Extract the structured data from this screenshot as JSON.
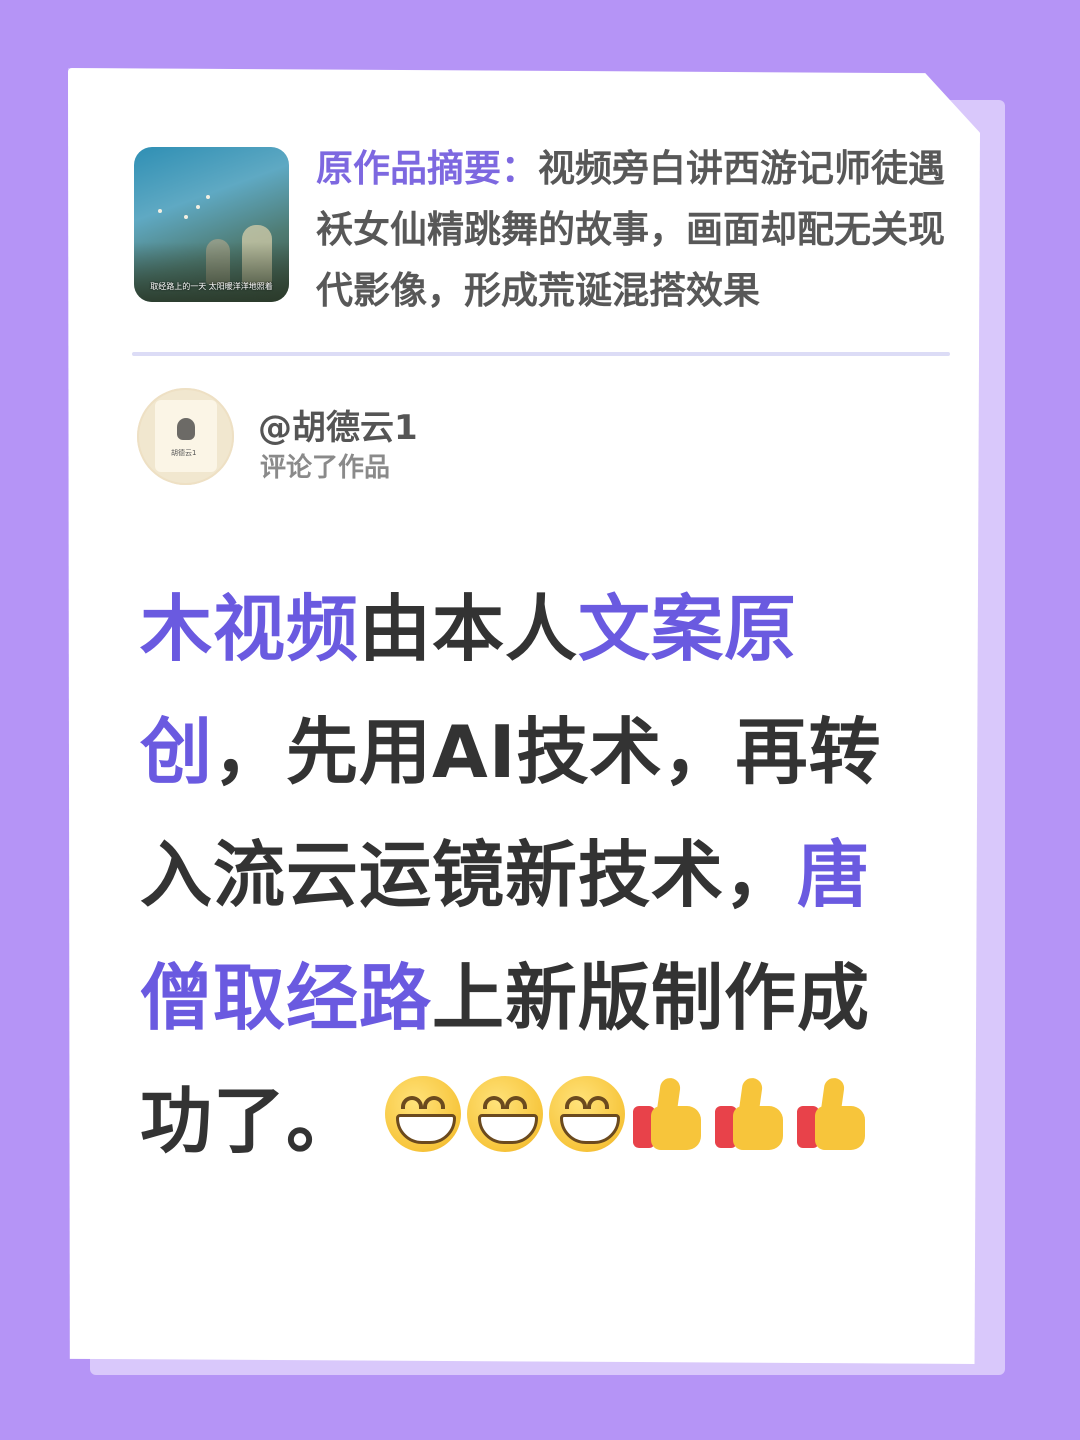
{
  "original_work": {
    "summary_label": "原作品摘要：",
    "summary_text": "视频旁白讲西游记师徒遇袄女仙精跳舞的故事，画面却配无关现代影像，形成荒诞混搭效果",
    "thumbnail_caption": "取经路上的一天 太阳暖洋洋地照着",
    "thumbnail_icon": "video-thumbnail"
  },
  "commenter": {
    "username": "@胡德云1",
    "action": "评论了作品",
    "avatar_caption": "胡德云1"
  },
  "comment": {
    "segments": [
      {
        "text": "木视频",
        "highlight": true
      },
      {
        "text": "由本人",
        "highlight": false
      },
      {
        "text": "文案原创",
        "highlight": true
      },
      {
        "text": "，先用AI技术，再转入流云运镜新技术，",
        "highlight": false
      },
      {
        "text": "唐僧取经路",
        "highlight": true
      },
      {
        "text": "上新版制作成功了。",
        "highlight": false
      }
    ],
    "emojis": [
      "grinning-face-icon",
      "grinning-face-icon",
      "grinning-face-icon",
      "thumbs-up-icon",
      "thumbs-up-icon",
      "thumbs-up-icon"
    ]
  },
  "colors": {
    "background": "#b594f6",
    "highlight": "#6a5ae0",
    "label": "#7d68e0"
  }
}
